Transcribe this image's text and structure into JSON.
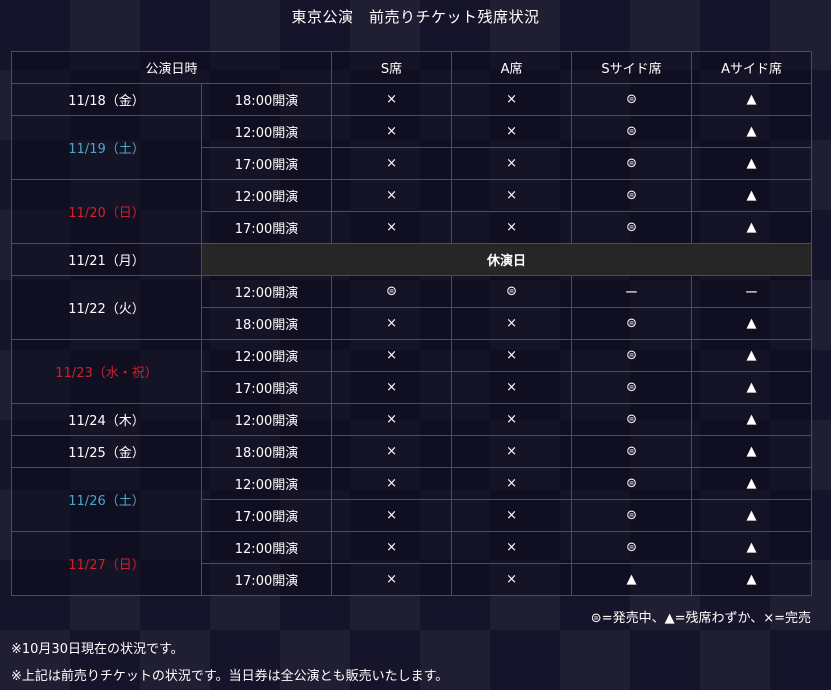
{
  "title": "東京公演　前売りチケット残席状況",
  "headers": [
    "公演日時",
    "S席",
    "A席",
    "Sサイド席",
    "Aサイド席"
  ],
  "colors": {
    "blue_date": "#4ca6c4",
    "red_date": "#d0202a",
    "white_date": "#ffffff",
    "border": "#3445c2"
  },
  "dates": [
    {
      "date": "11/18（金）",
      "color": "white",
      "shows": [
        {
          "time": "18:00開演",
          "s": "×",
          "a": "×",
          "ss": "⊜",
          "as": "▲"
        }
      ]
    },
    {
      "date": "11/19（土）",
      "color": "blue",
      "shows": [
        {
          "time": "12:00開演",
          "s": "×",
          "a": "×",
          "ss": "⊜",
          "as": "▲"
        },
        {
          "time": "17:00開演",
          "s": "×",
          "a": "×",
          "ss": "⊜",
          "as": "▲"
        }
      ]
    },
    {
      "date": "11/20（日）",
      "color": "red",
      "shows": [
        {
          "time": "12:00開演",
          "s": "×",
          "a": "×",
          "ss": "⊜",
          "as": "▲"
        },
        {
          "time": "17:00開演",
          "s": "×",
          "a": "×",
          "ss": "⊜",
          "as": "▲"
        }
      ]
    },
    {
      "date": "11/21（月）",
      "color": "white",
      "closed": "休演日",
      "shows": []
    },
    {
      "date": "11/22（火）",
      "color": "white",
      "shows": [
        {
          "time": "12:00開演",
          "s": "⊜",
          "a": "⊜",
          "ss": "ー",
          "as": "ー"
        },
        {
          "time": "18:00開演",
          "s": "×",
          "a": "×",
          "ss": "⊜",
          "as": "▲"
        }
      ]
    },
    {
      "date": "11/23（水・祝）",
      "color": "red",
      "shows": [
        {
          "time": "12:00開演",
          "s": "×",
          "a": "×",
          "ss": "⊜",
          "as": "▲"
        },
        {
          "time": "17:00開演",
          "s": "×",
          "a": "×",
          "ss": "⊜",
          "as": "▲"
        }
      ]
    },
    {
      "date": "11/24（木）",
      "color": "white",
      "shows": [
        {
          "time": "12:00開演",
          "s": "×",
          "a": "×",
          "ss": "⊜",
          "as": "▲"
        }
      ]
    },
    {
      "date": "11/25（金）",
      "color": "white",
      "shows": [
        {
          "time": "18:00開演",
          "s": "×",
          "a": "×",
          "ss": "⊜",
          "as": "▲"
        }
      ]
    },
    {
      "date": "11/26（土）",
      "color": "blue",
      "shows": [
        {
          "time": "12:00開演",
          "s": "×",
          "a": "×",
          "ss": "⊜",
          "as": "▲"
        },
        {
          "time": "17:00開演",
          "s": "×",
          "a": "×",
          "ss": "⊜",
          "as": "▲"
        }
      ]
    },
    {
      "date": "11/27（日）",
      "color": "red",
      "shows": [
        {
          "time": "12:00開演",
          "s": "×",
          "a": "×",
          "ss": "⊜",
          "as": "▲"
        },
        {
          "time": "17:00開演",
          "s": "×",
          "a": "×",
          "ss": "▲",
          "as": "▲"
        }
      ]
    }
  ],
  "legend": "⊜=発売中、▲=残席わずか、×=完売",
  "notes": [
    "※10月30日現在の状況です。",
    "※上記は前売りチケットの状況です。当日券は全公演とも販売いたします。"
  ]
}
